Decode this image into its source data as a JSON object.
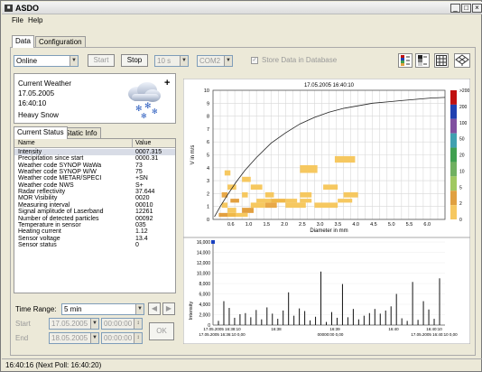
{
  "app": {
    "title": "ASDO",
    "icon_label": "ASDO"
  },
  "window_buttons": {
    "minimize": "_",
    "maximize": "□",
    "close": "×"
  },
  "menu": [
    {
      "label": "File"
    },
    {
      "label": "Help"
    }
  ],
  "main_tabs": [
    {
      "label": "Data",
      "active": true
    },
    {
      "label": "Configuration",
      "active": false
    }
  ],
  "toolbar": {
    "mode": "Online",
    "start_label": "Start",
    "stop_label": "Stop",
    "interval": "10 s",
    "port": "COM2",
    "store_label": "Store Data in Database",
    "store_checked": true,
    "view_icons": [
      "color-scale-icon",
      "grayscale-icon",
      "grid-view-icon",
      "3d-view-icon"
    ]
  },
  "weather": {
    "heading": "Current Weather",
    "date": "17.05.2005",
    "time": "16:40:10",
    "condition": "Heavy Snow",
    "plus": "+",
    "icon": "snow-cloud-icon"
  },
  "sub_tabs": [
    {
      "label": "Current Status",
      "active": true
    },
    {
      "label": "Static Info",
      "active": false
    }
  ],
  "status_table": {
    "headers": [
      "Name",
      "Value"
    ],
    "rows": [
      [
        "Intensity",
        "0007.315"
      ],
      [
        "Precipitation since start",
        "0000.31"
      ],
      [
        "Weather code SYNOP WaWa",
        "73"
      ],
      [
        "Weather code SYNOP W/W",
        "75"
      ],
      [
        "Weather code METAR/SPECI",
        "+SN"
      ],
      [
        "Weather code NWS",
        "S+"
      ],
      [
        "Radar reflectivity",
        "37.644"
      ],
      [
        "MOR Visibility",
        "0020"
      ],
      [
        "Measuring interval",
        "00010"
      ],
      [
        "Signal amplitude of Laserband",
        "12261"
      ],
      [
        "Number of detected particles",
        "00092"
      ],
      [
        "Temperature in sensor",
        "035"
      ],
      [
        "Heating current",
        "1.12"
      ],
      [
        "Sensor voltage",
        "13.4"
      ],
      [
        "Sensor status",
        "0"
      ]
    ]
  },
  "time_range": {
    "label": "Time Range:",
    "value": "5 min",
    "start_label": "Start",
    "end_label": "End",
    "start_date": "17.05.2005",
    "start_time": "00:00:00",
    "end_date": "18.05.2005",
    "end_time": "00:00:00",
    "ok_label": "OK"
  },
  "status_bar": {
    "text": "16:40:16 (Next Poll: 16:40:20)"
  },
  "chart_data": [
    {
      "type": "heatmap",
      "title": "17.05.2005 16:40:10",
      "xlabel": "Diameter in mm",
      "ylabel": "V in m/s",
      "xlim": [
        0,
        8
      ],
      "ylim": [
        0,
        10
      ],
      "x_ticks": [
        "0.6",
        "1.0",
        "1.5",
        "2.0",
        "2.5",
        "3.0",
        "3.5",
        "4.0",
        "4.5",
        "5.0",
        "5.5",
        "6.0"
      ],
      "y_ticks": [
        "0",
        "1",
        "2",
        "3",
        "4",
        "5",
        "6",
        "7",
        "8",
        "9",
        "10"
      ],
      "curve": [
        [
          0.05,
          0.2
        ],
        [
          0.25,
          1.0
        ],
        [
          0.5,
          1.9
        ],
        [
          0.8,
          2.9
        ],
        [
          1.1,
          3.8
        ],
        [
          1.5,
          4.8
        ],
        [
          2.0,
          5.9
        ],
        [
          2.5,
          6.7
        ],
        [
          3.0,
          7.4
        ],
        [
          3.5,
          7.9
        ],
        [
          4.0,
          8.3
        ],
        [
          4.5,
          8.6
        ],
        [
          5.0,
          8.8
        ],
        [
          5.5,
          9.0
        ],
        [
          6.0,
          9.1
        ],
        [
          6.5,
          9.2
        ],
        [
          7.0,
          9.3
        ],
        [
          7.5,
          9.4
        ],
        [
          8.0,
          9.45
        ]
      ],
      "cells": [
        {
          "x0": 0.2,
          "x1": 0.5,
          "y0": 0.2,
          "y1": 0.5,
          "color": "#e2a040"
        },
        {
          "x0": 0.5,
          "x1": 0.8,
          "y0": 0.2,
          "y1": 0.5,
          "color": "#f0b848"
        },
        {
          "x0": 0.8,
          "x1": 1.2,
          "y0": 0.2,
          "y1": 0.5,
          "color": "#f6c860"
        },
        {
          "x0": 0.5,
          "x1": 0.8,
          "y0": 0.5,
          "y1": 0.9,
          "color": "#f6c860"
        },
        {
          "x0": 1.0,
          "x1": 1.4,
          "y0": 0.5,
          "y1": 0.9,
          "color": "#e2a040"
        },
        {
          "x0": 0.3,
          "x1": 0.5,
          "y0": 0.9,
          "y1": 1.3,
          "color": "#f6c860"
        },
        {
          "x0": 1.3,
          "x1": 1.8,
          "y0": 0.9,
          "y1": 1.3,
          "color": "#f6c860"
        },
        {
          "x0": 1.8,
          "x1": 2.2,
          "y0": 0.9,
          "y1": 1.3,
          "color": "#e8a848"
        },
        {
          "x0": 2.5,
          "x1": 3.2,
          "y0": 0.9,
          "y1": 1.3,
          "color": "#f6c860"
        },
        {
          "x0": 3.5,
          "x1": 4.3,
          "y0": 0.9,
          "y1": 1.3,
          "color": "#f6c860"
        },
        {
          "x0": 0.6,
          "x1": 0.9,
          "y0": 1.3,
          "y1": 1.6,
          "color": "#e2a040"
        },
        {
          "x0": 1.5,
          "x1": 2.0,
          "y0": 1.3,
          "y1": 1.6,
          "color": "#f6c860"
        },
        {
          "x0": 2.0,
          "x1": 2.5,
          "y0": 1.3,
          "y1": 1.6,
          "color": "#f0b848"
        },
        {
          "x0": 2.5,
          "x1": 2.9,
          "y0": 1.3,
          "y1": 1.6,
          "color": "#f6c860"
        },
        {
          "x0": 3.0,
          "x1": 3.4,
          "y0": 1.3,
          "y1": 1.6,
          "color": "#f6c860"
        },
        {
          "x0": 4.3,
          "x1": 4.8,
          "y0": 1.3,
          "y1": 1.6,
          "color": "#f6c860"
        },
        {
          "x0": 0.3,
          "x1": 0.5,
          "y0": 1.7,
          "y1": 2.1,
          "color": "#e8a848"
        },
        {
          "x0": 1.0,
          "x1": 1.2,
          "y0": 1.7,
          "y1": 2.1,
          "color": "#f6c860"
        },
        {
          "x0": 1.8,
          "x1": 2.1,
          "y0": 1.7,
          "y1": 2.1,
          "color": "#f6c860"
        },
        {
          "x0": 3.0,
          "x1": 3.4,
          "y0": 1.7,
          "y1": 2.1,
          "color": "#f6c860"
        },
        {
          "x0": 4.5,
          "x1": 5.0,
          "y0": 1.7,
          "y1": 2.1,
          "color": "#f6c860"
        },
        {
          "x0": 0.5,
          "x1": 0.8,
          "y0": 2.3,
          "y1": 2.7,
          "color": "#f6c860"
        },
        {
          "x0": 1.3,
          "x1": 1.7,
          "y0": 2.3,
          "y1": 2.7,
          "color": "#f6c860"
        },
        {
          "x0": 3.8,
          "x1": 4.3,
          "y0": 2.3,
          "y1": 2.7,
          "color": "#f6c860"
        },
        {
          "x0": 1.0,
          "x1": 1.3,
          "y0": 2.9,
          "y1": 3.3,
          "color": "#f6c860"
        },
        {
          "x0": 0.4,
          "x1": 0.6,
          "y0": 3.4,
          "y1": 3.8,
          "color": "#f6c860"
        },
        {
          "x0": 3.0,
          "x1": 3.6,
          "y0": 3.6,
          "y1": 4.2,
          "color": "#f6c860"
        },
        {
          "x0": 4.2,
          "x1": 4.9,
          "y0": 4.4,
          "y1": 4.9,
          "color": "#f6c860"
        }
      ],
      "colorbar": {
        "labels": [
          ">200",
          "200",
          "100",
          "50",
          "20",
          "10",
          "5",
          "2",
          "0"
        ],
        "colors": [
          "#c01010",
          "#2040b0",
          "#8050a0",
          "#40a0b0",
          "#40a050",
          "#70b060",
          "#a0c860",
          "#e0a040",
          "#f6c860"
        ]
      }
    },
    {
      "type": "bar",
      "xlabel": "",
      "ylabel": "Intensity",
      "ylim": [
        0,
        16000
      ],
      "y_ticks": [
        "0",
        "2,000",
        "4,000",
        "6,000",
        "8,000",
        "10,000",
        "12,000",
        "14,000",
        "16,000"
      ],
      "x_tick_labels": [
        "17.05.2005 16:38:10",
        "16:38",
        "16:39",
        "16:40",
        "16:40:10"
      ],
      "x_tick_sublabels": [
        "17.05.2005 16:36:10  0,00",
        "00000:00  0,00",
        "17.05.2005 16:40:10  0,00"
      ],
      "values": [
        800,
        4600,
        3300,
        1400,
        2100,
        2300,
        1500,
        2900,
        1100,
        3400,
        2200,
        1200,
        2800,
        6300,
        1800,
        3200,
        2700,
        900,
        1600,
        10300,
        600,
        2500,
        1400,
        7900,
        1500,
        3100,
        1100,
        1800,
        2300,
        3100,
        2200,
        2800,
        3600,
        6000,
        1300,
        800,
        8300,
        1000,
        4600,
        3000,
        1200,
        9000
      ],
      "current_marker": 16000
    }
  ]
}
